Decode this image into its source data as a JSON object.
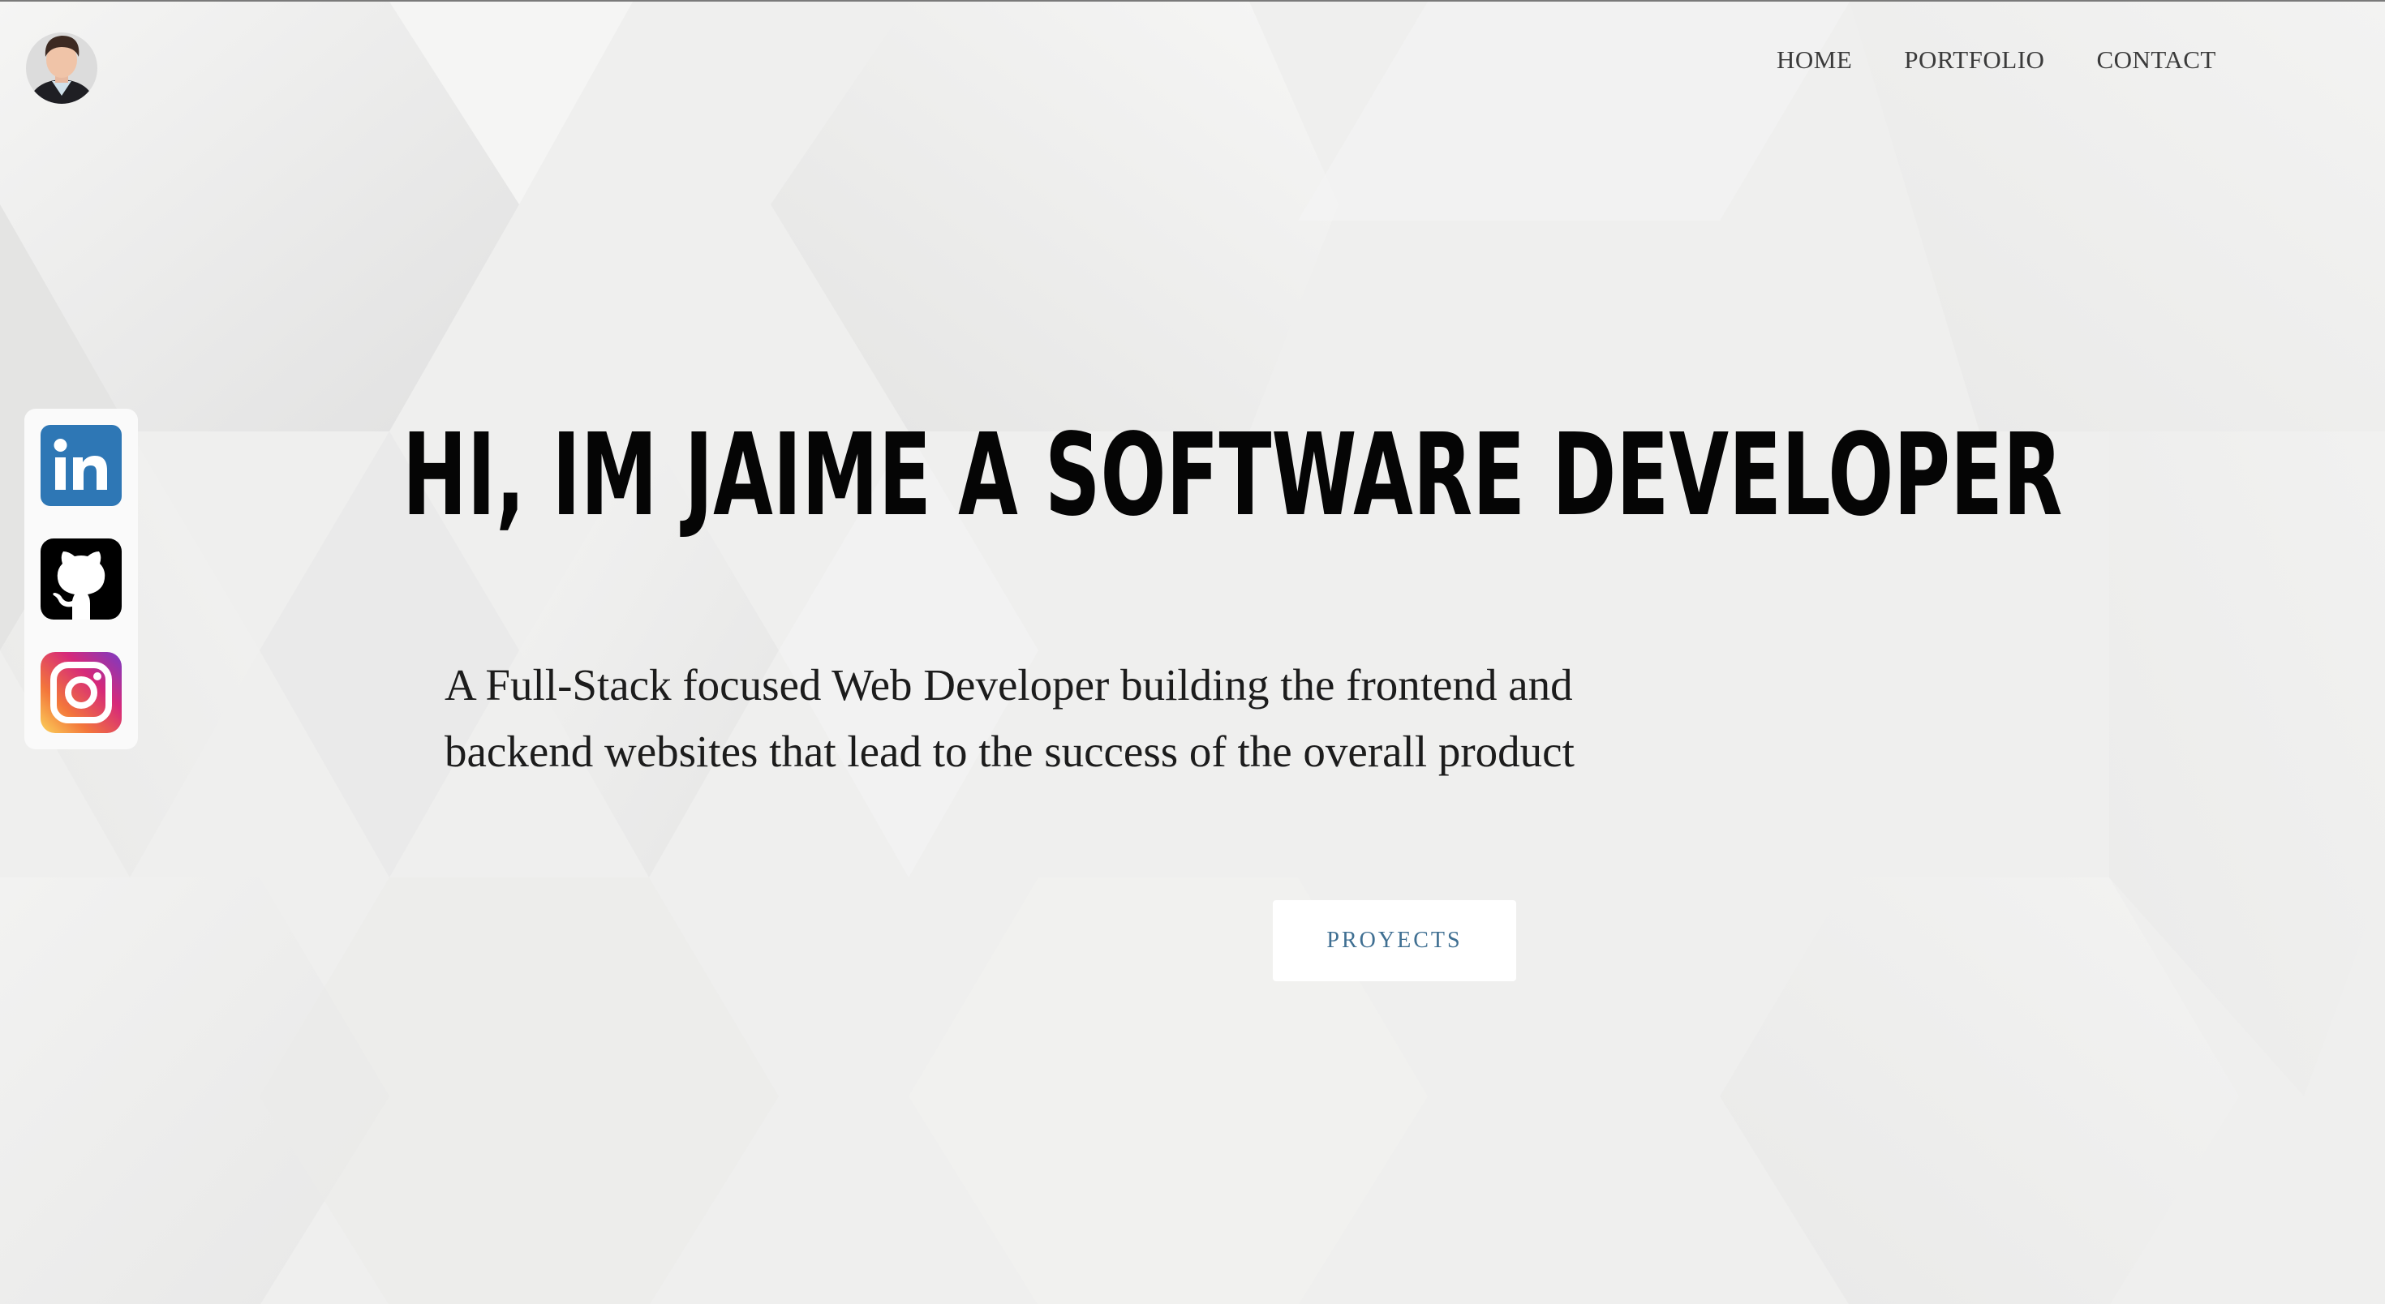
{
  "nav": {
    "items": [
      {
        "label": "HOME"
      },
      {
        "label": "PORTFOLIO"
      },
      {
        "label": "CONTACT"
      }
    ]
  },
  "hero": {
    "headline": "HI, IM JAIME A SOFTWARE DEVELOPER",
    "tagline": "A Full-Stack focused Web Developer building the frontend and backend websites that lead to the success of the overall product",
    "cta_label": "PROYECTS"
  },
  "social": [
    {
      "icon": "linkedin-icon",
      "color": "#2e77b5"
    },
    {
      "icon": "github-icon",
      "color": "#000000"
    },
    {
      "icon": "instagram-icon",
      "color": "#d6297a"
    }
  ],
  "colors": {
    "background": "#efefee",
    "heading": "#050505",
    "cta_text": "#3f6f92"
  }
}
